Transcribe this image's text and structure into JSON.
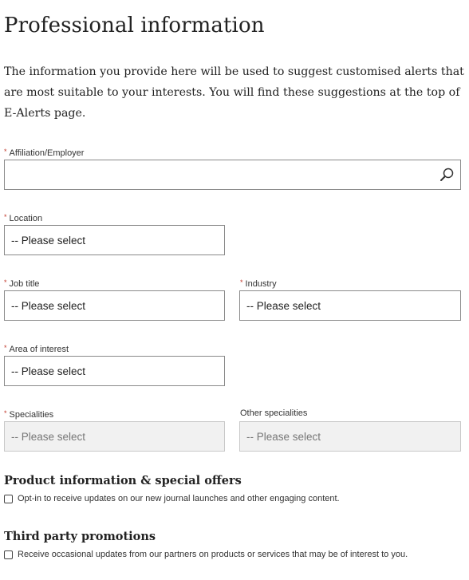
{
  "page": {
    "title": "Professional information",
    "intro": "The information you provide here will be used to suggest customised alerts that are most suitable to your interests. You will find these suggestions at the top of E-Alerts page."
  },
  "form": {
    "required_marker": "*",
    "affiliation": {
      "label": "Affiliation/Employer",
      "value": "",
      "icon": "search-icon"
    },
    "location": {
      "label": "Location",
      "value": "-- Please select"
    },
    "job_title": {
      "label": "Job title",
      "value": "-- Please select"
    },
    "industry": {
      "label": "Industry",
      "value": "-- Please select"
    },
    "area_of_interest": {
      "label": "Area of interest",
      "value": "-- Please select"
    },
    "specialities": {
      "label": "Specialities",
      "value": "-- Please select",
      "disabled": true
    },
    "other_specialities": {
      "label": "Other specialities",
      "value": "-- Please select",
      "disabled": true
    }
  },
  "product_info": {
    "title": "Product information & special offers",
    "checkbox_label": "Opt-in to receive updates on our new journal launches and other engaging content.",
    "checked": false
  },
  "third_party": {
    "title": "Third party promotions",
    "checkbox_label": "Receive occasional updates from our partners on products or services that may be of interest to you.",
    "checked": false
  },
  "colors": {
    "required": "#c0392b",
    "border": "#8a8a8a",
    "disabled_bg": "#f1f1f1"
  }
}
